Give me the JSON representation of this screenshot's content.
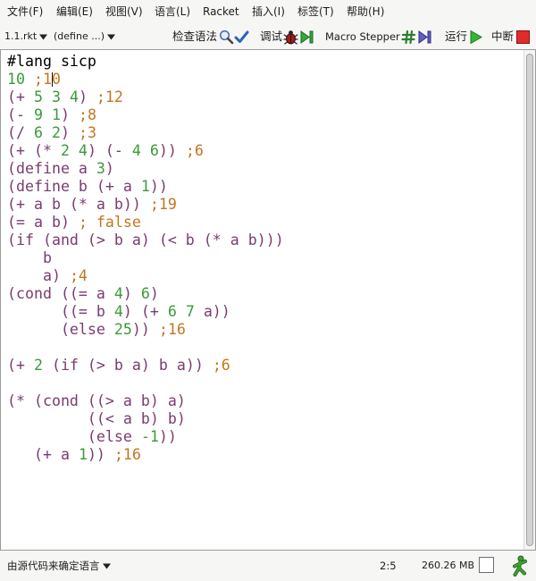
{
  "menu": {
    "items": [
      "文件(F)",
      "编辑(E)",
      "视图(V)",
      "语言(L)",
      "Racket",
      "插入(I)",
      "标签(T)",
      "帮助(H)"
    ]
  },
  "toolbar": {
    "file_dropdown": {
      "label": "1.1.rkt",
      "icon": "chevron-down-icon"
    },
    "define_dropdown": {
      "label": "(define ...)",
      "icon": "chevron-down-icon"
    },
    "check_syntax": {
      "label": "检查语法",
      "icons": [
        "magnifier-icon",
        "checkmark-icon"
      ]
    },
    "debug": {
      "label": "调试",
      "icons": [
        "bug-icon",
        "step-icon"
      ]
    },
    "macro_stepper": {
      "label": "Macro Stepper",
      "icons": [
        "hash-icon",
        "step-icon"
      ]
    },
    "run": {
      "label": "运行",
      "icon": "play-icon"
    },
    "break": {
      "label": "中断",
      "icon": "stop-icon"
    }
  },
  "colors": {
    "lang": "#000000",
    "symbol": "#7a3b6e",
    "number": "#3a9a3a",
    "comment": "#c2761f",
    "run_green": "#36b336",
    "debug_green": "#35a83a",
    "macro_step_blue": "#5f5fc8",
    "break_red": "#e02b2b"
  },
  "editor": {
    "lines": [
      [
        {
          "lang": "#lang sicp"
        }
      ],
      [
        {
          "number": "10 "
        },
        {
          "comment": ";10"
        }
      ],
      [
        {
          "symbol": "(+ "
        },
        {
          "number": "5 3 4"
        },
        {
          "symbol": ") "
        },
        {
          "comment": ";12"
        }
      ],
      [
        {
          "symbol": "(- "
        },
        {
          "number": "9 1"
        },
        {
          "symbol": ") "
        },
        {
          "comment": ";8"
        }
      ],
      [
        {
          "symbol": "(/ "
        },
        {
          "number": "6 2"
        },
        {
          "symbol": ") "
        },
        {
          "comment": ";3"
        }
      ],
      [
        {
          "symbol": "(+ (* "
        },
        {
          "number": "2 4"
        },
        {
          "symbol": ") (- "
        },
        {
          "number": "4 6"
        },
        {
          "symbol": ")) "
        },
        {
          "comment": ";6"
        }
      ],
      [
        {
          "symbol": "(define a "
        },
        {
          "number": "3"
        },
        {
          "symbol": ")"
        }
      ],
      [
        {
          "symbol": "(define b (+ a "
        },
        {
          "number": "1"
        },
        {
          "symbol": "))"
        }
      ],
      [
        {
          "symbol": "(+ a b (* a b)) "
        },
        {
          "comment": ";19"
        }
      ],
      [
        {
          "symbol": "(= a b) "
        },
        {
          "comment": "; false"
        }
      ],
      [
        {
          "symbol": "(if (and (> b a) (< b (* a b)))"
        }
      ],
      [
        {
          "symbol": "    b"
        }
      ],
      [
        {
          "symbol": "    a) "
        },
        {
          "comment": ";4"
        }
      ],
      [
        {
          "symbol": "(cond ((= a "
        },
        {
          "number": "4"
        },
        {
          "symbol": ") "
        },
        {
          "number": "6"
        },
        {
          "symbol": ")"
        }
      ],
      [
        {
          "symbol": "      ((= b "
        },
        {
          "number": "4"
        },
        {
          "symbol": ") (+ "
        },
        {
          "number": "6 7"
        },
        {
          "symbol": " a))"
        }
      ],
      [
        {
          "symbol": "      (else "
        },
        {
          "number": "25"
        },
        {
          "symbol": ")) "
        },
        {
          "comment": ";16"
        }
      ],
      [],
      [
        {
          "symbol": "(+ "
        },
        {
          "number": "2"
        },
        {
          "symbol": " (if (> b a) b a)) "
        },
        {
          "comment": ";6"
        }
      ],
      [],
      [
        {
          "symbol": "(* (cond ((> a b) a)"
        }
      ],
      [
        {
          "symbol": "         ((< a b) b)"
        }
      ],
      [
        {
          "symbol": "         (else "
        },
        {
          "number": "-1"
        },
        {
          "symbol": "))"
        }
      ],
      [
        {
          "symbol": "   (+ a "
        },
        {
          "number": "1"
        },
        {
          "symbol": ")) "
        },
        {
          "comment": ";16"
        }
      ]
    ]
  },
  "status": {
    "language": "由源代码来确定语言",
    "language_icon": "chevron-down-icon",
    "position": "2:5",
    "memory": "260.26 MB",
    "icons": [
      "gc-box-icon",
      "running-icon"
    ]
  }
}
